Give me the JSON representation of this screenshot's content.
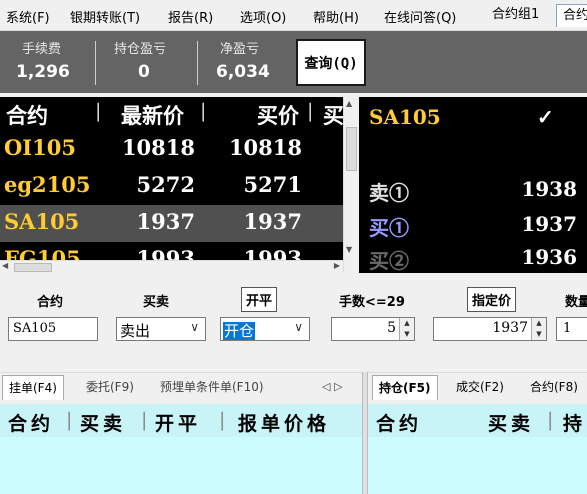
{
  "menu": {
    "items": [
      "系统(F)",
      "银期转账(T)",
      "报告(R)",
      "选项(O)",
      "帮助(H)",
      "在线问答(Q)"
    ],
    "tabs": [
      "合约组1",
      "合约"
    ]
  },
  "stats": {
    "fee_label": "手续费",
    "fee_value": "1,296",
    "position_pnl_label": "持仓盈亏",
    "position_pnl_value": "0",
    "net_pnl_label": "净盈亏",
    "net_pnl_value": "6,034",
    "query_button": "查询(Q)"
  },
  "quote_table": {
    "headers": [
      "合约",
      "最新价",
      "买价",
      "买"
    ],
    "rows": [
      {
        "contract": "OI105",
        "last": "10818",
        "bid": "10818"
      },
      {
        "contract": "eg2105",
        "last": "5272",
        "bid": "5271"
      },
      {
        "contract": "SA105",
        "last": "1937",
        "bid": "1937"
      },
      {
        "contract": "FG105",
        "last": "1993",
        "bid": "1993"
      }
    ]
  },
  "depth": {
    "contract": "SA105",
    "check": "✓",
    "levels": [
      {
        "label": "卖①",
        "price": "1938"
      },
      {
        "label": "买①",
        "price": "1937"
      },
      {
        "label": "买②",
        "price": "1936"
      }
    ]
  },
  "order_form": {
    "contract_label": "合约",
    "contract_value": "SA105",
    "side_label": "买卖",
    "side_value": "卖出",
    "offset_label": "开平",
    "offset_value": "开仓",
    "lots_label": "手数<=29",
    "lots_value": "5",
    "price_label": "指定价",
    "price_value": "1937",
    "qty_label": "数量",
    "qty_value": "1"
  },
  "left_panel": {
    "tabs": [
      "挂单(F4)",
      "委托(F9)",
      "预埋单条件单(F10)"
    ],
    "nav": "◁ ▷",
    "headers": [
      "合约",
      "买卖",
      "开平",
      "报单价格"
    ]
  },
  "right_panel": {
    "tabs": [
      "持仓(F5)",
      "成交(F2)",
      "合约(F8)"
    ],
    "headers": [
      "合约",
      "买卖",
      "持"
    ]
  },
  "colors": {
    "quote_bg": "#000000",
    "contract_color": "#ffcc33",
    "highlight_row": "#505050",
    "sell_color": "#e0e0e0",
    "buy_color": "#9999ff",
    "panel_header_bg": "#c8f4f8"
  }
}
